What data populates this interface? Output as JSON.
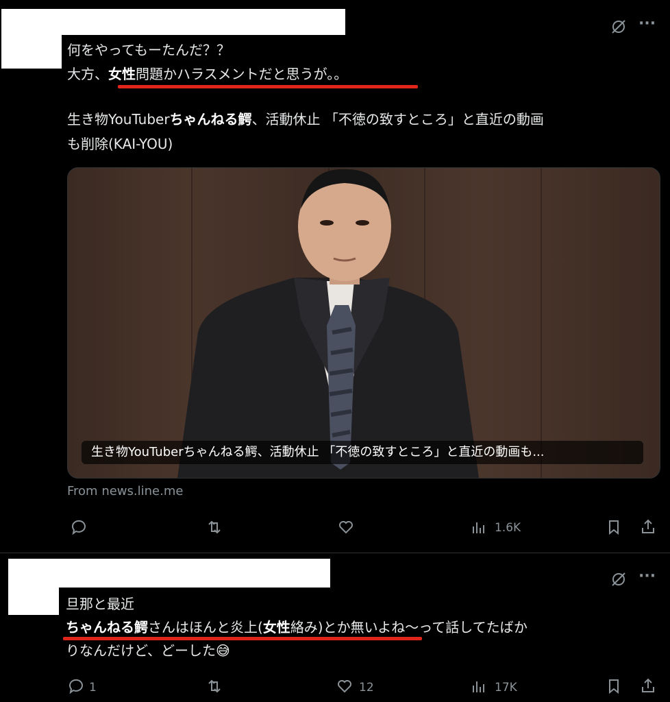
{
  "tweet1": {
    "lines": [
      "何をやってもーたんだ？？"
    ],
    "line2_pre": "大方、",
    "line2_hl": "女性",
    "line2_post": "問題かハラスメントだと思うが。。",
    "article_line1_a": "生き物YouTuber",
    "article_line1_b": "ちゃんねる鰐",
    "article_line1_c": "、活動休止 「不徳の致すところ」と直近の動画",
    "article_line2": "も削除(KAI-YOU)",
    "card_caption": "生き物YouTuberちゃんねる鰐、活動休止 「不徳の致すところ」と直近の動画も...",
    "source": "From news.line.me",
    "views": "1.6K"
  },
  "tweet2": {
    "line1": "旦那と最近",
    "line2_hl1": "ちゃんねる鰐",
    "line2_mid": "さんはほんと炎上(",
    "line2_hl2": "女性",
    "line2_post": "絡み)とか無いよね〜って話してたばか",
    "line3": "りなんだけど、どーした",
    "emoji": "😅",
    "replies": "1",
    "likes": "12",
    "views": "17K"
  },
  "menu_glyph": "···",
  "colors": {
    "underline": "#e0261b",
    "muted": "#8b9399"
  }
}
